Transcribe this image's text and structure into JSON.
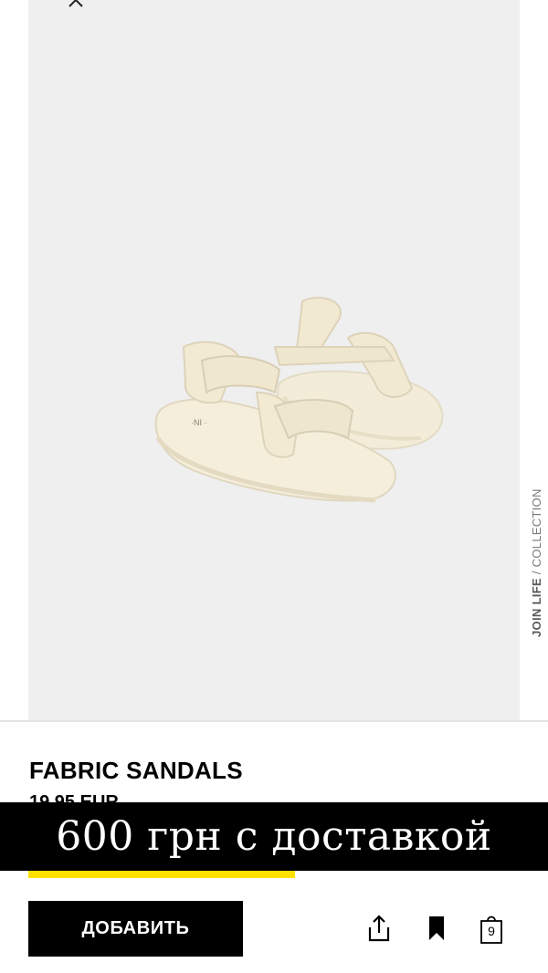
{
  "product": {
    "title": "FABRIC SANDALS",
    "price_partial": "19.95 EUR",
    "collection_brand": "JOIN LIFE",
    "collection_suffix": " / COLLECTION"
  },
  "promo": {
    "text": "600 грн с доставкой"
  },
  "actions": {
    "add_label": "ДОБАВИТЬ",
    "bag_count": "9"
  },
  "icons": {
    "close": "close-icon",
    "share": "share-icon",
    "bookmark": "bookmark-icon",
    "bag": "shopping-bag-icon"
  },
  "colors": {
    "accent_yellow": "#ffe100",
    "banner_bg": "#000000",
    "photo_bg": "#efeff0"
  }
}
